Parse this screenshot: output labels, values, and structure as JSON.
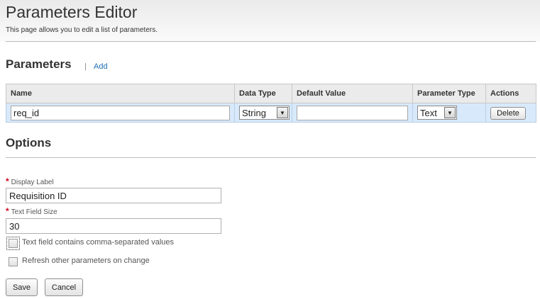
{
  "header": {
    "title": "Parameters Editor",
    "description": "This page allows you to edit a list of parameters."
  },
  "parameters": {
    "title": "Parameters",
    "separator": "|",
    "add_label": "Add",
    "columns": [
      "Name",
      "Data Type",
      "Default Value",
      "Parameter Type",
      "Actions"
    ],
    "rows": [
      {
        "name": "req_id",
        "data_type": "String",
        "default_value": "",
        "parameter_type": "Text",
        "action_label": "Delete"
      }
    ]
  },
  "options": {
    "title": "Options",
    "required_marker": "*",
    "display_label": {
      "label": "Display Label",
      "value": "Requisition ID"
    },
    "text_field_size": {
      "label": "Text Field Size",
      "value": "30"
    },
    "checkboxes": [
      {
        "label": "Text field contains comma-separated values",
        "checked": false
      },
      {
        "label": "Refresh other parameters on change",
        "checked": false
      }
    ]
  },
  "footer": {
    "save_label": "Save",
    "cancel_label": "Cancel"
  },
  "icons": {
    "dropdown": "chevron-down-icon",
    "checkbox": "checkbox-icon"
  },
  "colors": {
    "accent_link": "#1f6fb6",
    "row_selected": "#d8e9fb",
    "required": "#d0001a"
  }
}
